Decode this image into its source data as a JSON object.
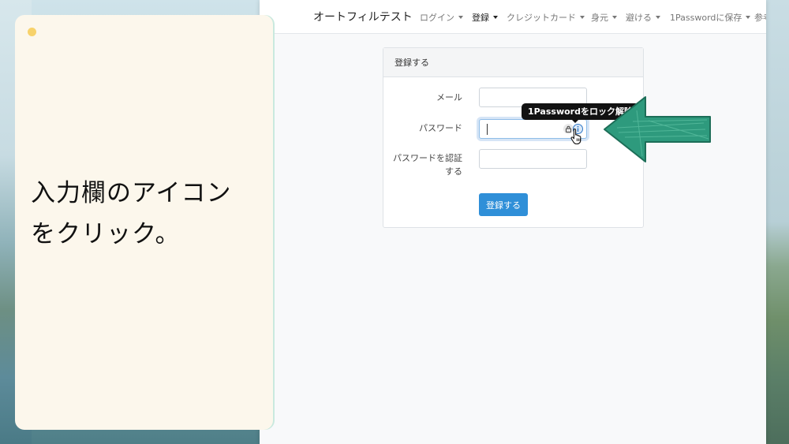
{
  "navbar": {
    "brand": "オートフィルテスト",
    "items": [
      {
        "label": "ログイン"
      },
      {
        "label": "登録"
      },
      {
        "label": "クレジットカード"
      },
      {
        "label": "身元"
      },
      {
        "label": "避ける"
      },
      {
        "label": "1Passwordに保存"
      },
      {
        "label": "参考"
      }
    ]
  },
  "card": {
    "header": "登録する",
    "email_label": "メール",
    "email_value": "",
    "password_label": "パスワード",
    "password_value": "",
    "confirm_label_line1": "パスワードを認証",
    "confirm_label_line2": "する",
    "confirm_value": "",
    "submit_label": "登録する"
  },
  "tooltip": {
    "text": "1Passwordをロック解除"
  },
  "note": {
    "line1": "入力欄のアイコン",
    "line2": "をクリック。"
  },
  "colors": {
    "accent": "#2f8fd8",
    "arrow": "#2e9a7d",
    "note_bg": "#fcf7ec",
    "dot": "#f7d26b"
  },
  "icons": {
    "lock": "lock-icon",
    "info": "info-icon",
    "cursor": "hand-pointer-icon",
    "arrow": "left-arrow-icon"
  }
}
